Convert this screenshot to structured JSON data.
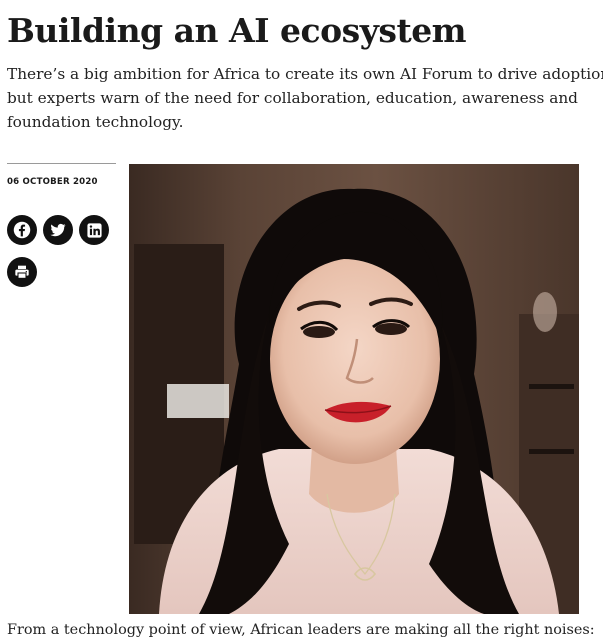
{
  "article": {
    "headline": "Building an AI ecosystem",
    "standfirst_lines": [
      "There’s a big ambition for Africa to create its own AI Forum to drive adoption,",
      "but experts warn of the need for collaboration, education, awareness and",
      "foundation technology."
    ],
    "date": "06 OCTOBER 2020",
    "body_first_line": "From a technology point of view, African leaders are making all the right noises:"
  },
  "share": {
    "icons": [
      "facebook-icon",
      "twitter-icon",
      "linkedin-icon",
      "print-icon"
    ]
  },
  "colors": {
    "text": "#1a1a1a",
    "share_icon_bg": "#111111",
    "rule": "#9a9a9a"
  }
}
